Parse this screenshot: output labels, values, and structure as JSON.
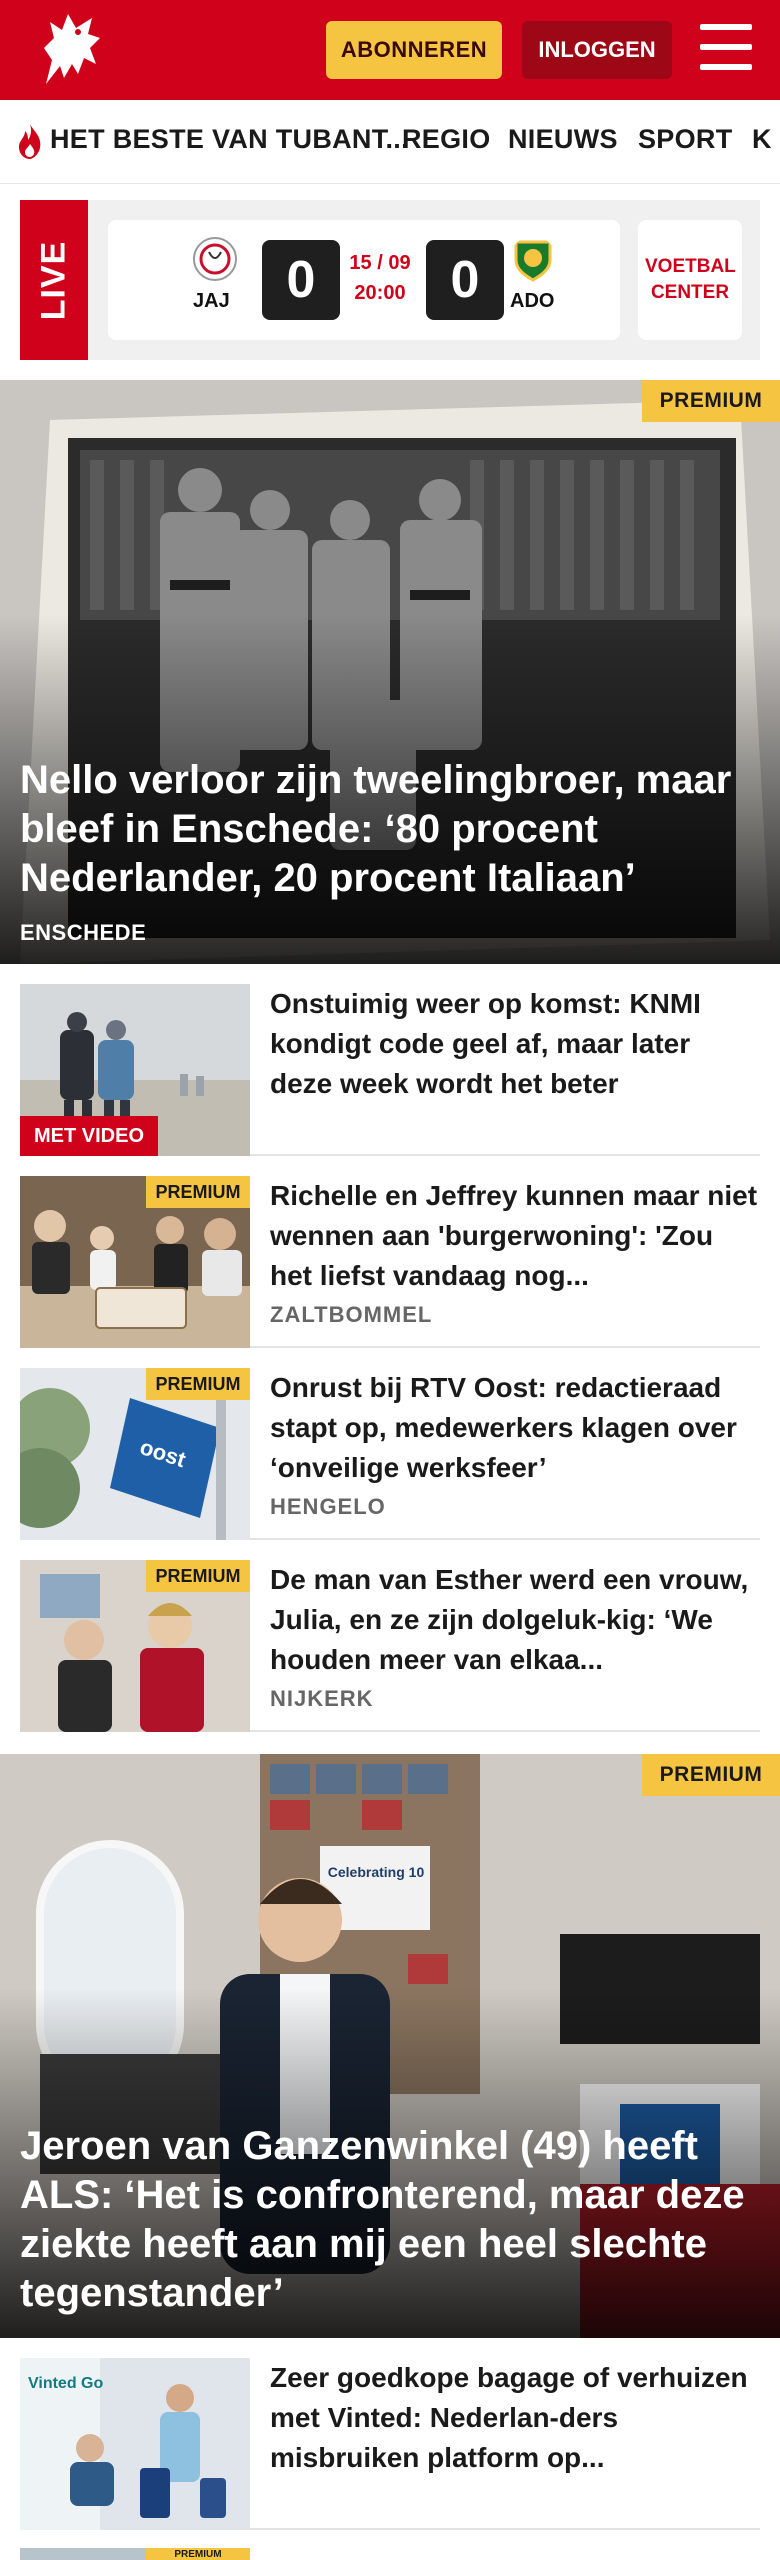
{
  "header": {
    "subscribe_label": "ABONNEREN",
    "login_label": "INLOGGEN",
    "brand_color": "#d0021b"
  },
  "nav": {
    "items": [
      {
        "label": "HET BESTE VAN TUBANT..."
      },
      {
        "label": "REGIO"
      },
      {
        "label": "NIEUWS"
      },
      {
        "label": "SPORT"
      },
      {
        "label": "K"
      }
    ]
  },
  "live": {
    "label": "LIVE",
    "home_team": "JAJ",
    "away_team": "ADO",
    "home_score": "0",
    "away_score": "0",
    "date": "15 / 09",
    "time": "20:00",
    "voetbal_center": "VOETBAL CENTER"
  },
  "hero1": {
    "badge": "PREMIUM",
    "title": "Nello verloor zijn tweelingbroer, maar bleef in Enschede: ‘80 procent Nederlander, 20 procent Italiaan’",
    "location": "ENSCHEDE"
  },
  "articles": [
    {
      "badge": "MET VIDEO",
      "title": "Onstuimig weer op komst: KNMI kondigt code geel af, maar later deze week wordt het beter",
      "location": ""
    },
    {
      "badge": "PREMIUM",
      "title": "Richelle en Jeffrey kunnen maar niet wennen aan 'burgerwoning': 'Zou het liefst vandaag nog...",
      "location": "ZALTBOMMEL"
    },
    {
      "badge": "PREMIUM",
      "title": "Onrust bij RTV Oost: redactieraad stapt op, medewerkers klagen over ‘onveilige werksfeer’",
      "location": "HENGELO"
    },
    {
      "badge": "PREMIUM",
      "title": "De man van Esther werd een vrouw, Julia, en ze zijn dolgeluk-kig: ‘We houden meer van elkaa...",
      "location": "NIJKERK"
    }
  ],
  "hero2": {
    "badge": "PREMIUM",
    "title": "Jeroen van Ganzenwinkel (49) heeft ALS: ‘Het is confronterend, maar deze ziekte heeft aan mij een heel slechte tegenstander’",
    "wall_caption": "Celebrating 10"
  },
  "article_last": {
    "title": "Zeer goedkope bagage of verhuizen met Vinted: Nederlan-ders misbruiken platform op...",
    "thumb_text": "Vinted Go",
    "next_badge": "PREMIUM"
  }
}
